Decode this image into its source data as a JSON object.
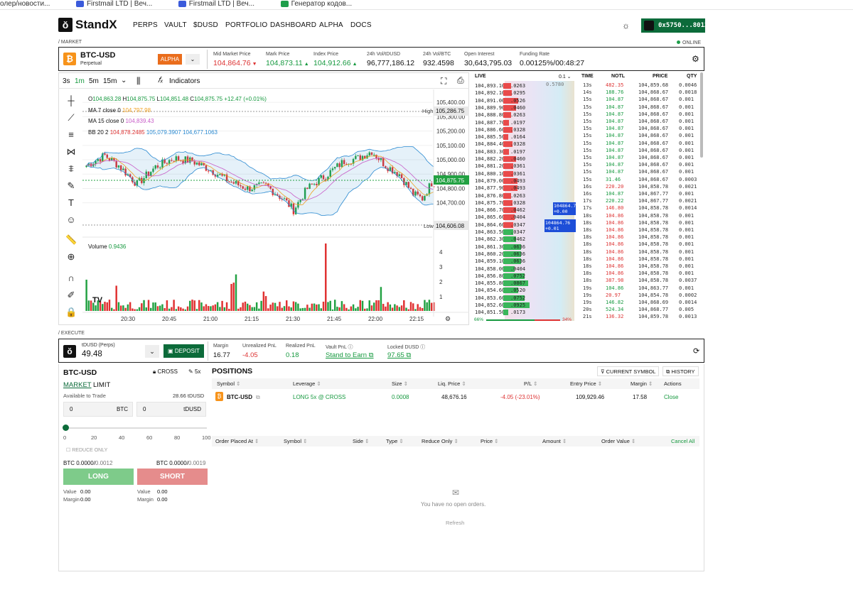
{
  "bookmarks": [
    "олер/новости...",
    "Firstmail LTD | Веч...",
    "Firstmail LTD | Веч...",
    "Генератор кодов..."
  ],
  "nav": {
    "logo": "StandX",
    "links": [
      "PERPS",
      "VAULT",
      "$DUSD",
      "PORTFOLIO",
      "DASHBOARD",
      "ALPHA",
      "DOCS"
    ],
    "wallet": "0x5750...8012"
  },
  "section_market": "/ MARKET",
  "online": "ONLINE",
  "market": {
    "symbol": "BTC-USD",
    "type": "Perpetual",
    "badge": "ALPHA",
    "stats": [
      {
        "label": "Mid Market Price",
        "value": "104,864.76",
        "color": "red",
        "arrow": "down"
      },
      {
        "label": "Mark Price",
        "value": "104,873.11",
        "color": "green",
        "arrow": "up"
      },
      {
        "label": "Index Price",
        "value": "104,912.66",
        "color": "green",
        "arrow": "up"
      },
      {
        "label": "24h Vol/tDUSD",
        "value": "96,777,186.12",
        "color": "black",
        "arrow": ""
      },
      {
        "label": "24h Vol/BTC",
        "value": "932.4598",
        "color": "black",
        "arrow": ""
      },
      {
        "label": "Open Interest",
        "value": "30,643,795.03",
        "color": "black",
        "arrow": ""
      },
      {
        "label": "Funding Rate",
        "value": "0.00125%/00:48:27",
        "color": "black",
        "arrow": ""
      }
    ]
  },
  "chart": {
    "intervals": [
      "3s",
      "1m",
      "5m",
      "15m"
    ],
    "active_interval": "1m",
    "indicators_label": "Indicators",
    "ohlc": {
      "o": "104,863.28",
      "h": "104,875.75",
      "l": "104,851.48",
      "c": "104,875.75",
      "chg": "+12.47 (+0.01%)"
    },
    "ma7": {
      "label": "MA 7 close 0",
      "value": "104,797.98"
    },
    "ma15": {
      "label": "MA 15 close 0",
      "value": "104,839.43"
    },
    "bb": {
      "label": "BB 20 2",
      "v1": "104,878.2485",
      "v2": "105,079.3907",
      "v3": "104,677.1063"
    },
    "volume_label": "Volume",
    "volume_value": "0.9436",
    "high_label": "High",
    "high_value": "105,286.75",
    "low_label": "Low",
    "low_value": "104,606.08",
    "current_price": "104,875.75",
    "price_ticks": [
      "105,400.00",
      "105,300.00",
      "105,200.00",
      "105,100.00",
      "105,000.00",
      "104,900.00",
      "104,800.00",
      "104,700.00"
    ],
    "vol_ticks": [
      "4",
      "3",
      "2",
      "1"
    ],
    "time_ticks": [
      "20:30",
      "20:45",
      "21:00",
      "21:15",
      "21:30",
      "21:45",
      "22:00",
      "22:15"
    ]
  },
  "chart_data": {
    "type": "candlestick",
    "x_label": "time",
    "y_label": "price",
    "ylim": [
      104550,
      105450
    ],
    "series_colors": {
      "up": "#22a142",
      "down": "#e03131",
      "ma7": "#f0a020",
      "ma15": "#c85cc8",
      "bb": "#2b8ad1"
    }
  },
  "orderbook": {
    "title": "LIVE",
    "step": "0.1",
    "asks": [
      [
        "104,893.10",
        ".0263"
      ],
      [
        "104,892.10",
        ".0295"
      ],
      [
        "104,891.00",
        ".0526"
      ],
      [
        "104,889.90",
        ".0460"
      ],
      [
        "104,888.80",
        ".0263"
      ],
      [
        "104,887.70",
        ".0197"
      ],
      [
        "104,886.60",
        ".0328"
      ],
      [
        "104,885.50",
        ".0164"
      ],
      [
        "104,884.40",
        ".0328"
      ],
      [
        "104,883.30",
        ".0197"
      ],
      [
        "104,882.20",
        ".0460"
      ],
      [
        "104,881.20",
        ".0361"
      ],
      [
        "104,880.10",
        ".0361"
      ],
      [
        "104,879.00",
        ".0493"
      ],
      [
        "104,877.90",
        ".0493"
      ],
      [
        "104,876.80",
        ".0263"
      ],
      [
        "104,875.70",
        ".0328"
      ],
      [
        "104,866.70",
        ".0462"
      ],
      [
        "104,865.60",
        ".0404"
      ],
      [
        "104,864.60",
        ".0347"
      ]
    ],
    "bids": [
      [
        "104,863.50",
        ".0347"
      ],
      [
        "104,862.30",
        ".0462"
      ],
      [
        "104,861.30",
        ".0636"
      ],
      [
        "104,860.20",
        ".0636"
      ],
      [
        "104,859.10",
        ".0636"
      ],
      [
        "104,858.00",
        ".0404"
      ],
      [
        "104,856.80",
        ".0752"
      ],
      [
        "104,855.80",
        ".0867"
      ],
      [
        "104,854.60",
        ".0520"
      ],
      [
        "104,853.60",
        ".0752"
      ],
      [
        "104,852.60",
        ".0925"
      ],
      [
        "104,851.50",
        ".0173"
      ]
    ],
    "tag1": "104864.76",
    "tag1b": "+0.00",
    "tag2": "104864.76",
    "tag2b": "+0.01",
    "top_value": "0.5780",
    "bid_pct": "66%",
    "ask_pct": "34%"
  },
  "trades": {
    "headers": [
      "TIME",
      "NOTL",
      "PRICE",
      "QTY"
    ],
    "rows": [
      [
        "13s",
        "482.35",
        "104,859.68",
        "0.0046",
        "r"
      ],
      [
        "14s",
        "188.76",
        "104,868.67",
        "0.0018",
        "g"
      ],
      [
        "15s",
        "104.87",
        "104,868.67",
        "0.001",
        "g"
      ],
      [
        "15s",
        "104.87",
        "104,868.67",
        "0.001",
        "g"
      ],
      [
        "15s",
        "104.87",
        "104,868.67",
        "0.001",
        "g"
      ],
      [
        "15s",
        "104.87",
        "104,868.67",
        "0.001",
        "g"
      ],
      [
        "15s",
        "104.87",
        "104,868.67",
        "0.001",
        "g"
      ],
      [
        "15s",
        "104.87",
        "104,868.67",
        "0.001",
        "g"
      ],
      [
        "15s",
        "104.87",
        "104,868.67",
        "0.001",
        "g"
      ],
      [
        "15s",
        "104.87",
        "104,868.67",
        "0.001",
        "g"
      ],
      [
        "15s",
        "104.87",
        "104,868.67",
        "0.001",
        "g"
      ],
      [
        "15s",
        "104.87",
        "104,868.67",
        "0.001",
        "g"
      ],
      [
        "15s",
        "104.87",
        "104,868.67",
        "0.001",
        "g"
      ],
      [
        "15s",
        "31.46",
        "104,868.67",
        "0.0003",
        "g"
      ],
      [
        "16s",
        "220.20",
        "104,858.78",
        "0.0021",
        "r"
      ],
      [
        "16s",
        "104.87",
        "104,867.77",
        "0.001",
        "g"
      ],
      [
        "17s",
        "220.22",
        "104,867.77",
        "0.0021",
        "g"
      ],
      [
        "17s",
        "146.80",
        "104,858.78",
        "0.0014",
        "r"
      ],
      [
        "18s",
        "104.86",
        "104,858.78",
        "0.001",
        "r"
      ],
      [
        "18s",
        "104.86",
        "104,858.78",
        "0.001",
        "r"
      ],
      [
        "18s",
        "104.86",
        "104,858.78",
        "0.001",
        "r"
      ],
      [
        "18s",
        "104.86",
        "104,858.78",
        "0.001",
        "r"
      ],
      [
        "18s",
        "104.86",
        "104,858.78",
        "0.001",
        "r"
      ],
      [
        "18s",
        "104.86",
        "104,858.78",
        "0.001",
        "r"
      ],
      [
        "18s",
        "104.86",
        "104,858.78",
        "0.001",
        "r"
      ],
      [
        "18s",
        "104.86",
        "104,858.78",
        "0.001",
        "r"
      ],
      [
        "18s",
        "104.86",
        "104,858.78",
        "0.001",
        "r"
      ],
      [
        "18s",
        "387.98",
        "104,858.78",
        "0.0037",
        "r"
      ],
      [
        "19s",
        "104.86",
        "104,863.77",
        "0.001",
        "g"
      ],
      [
        "19s",
        "20.97",
        "104,854.78",
        "0.0002",
        "r"
      ],
      [
        "19s",
        "146.82",
        "104,868.69",
        "0.0014",
        "g"
      ],
      [
        "20s",
        "524.34",
        "104,868.77",
        "0.005",
        "g"
      ],
      [
        "21s",
        "136.32",
        "104,859.78",
        "0.0013",
        "r"
      ]
    ]
  },
  "section_execute": "/ EXECUTE",
  "account": {
    "asset": "tDUSD (Perps)",
    "balance": "49.48",
    "deposit": "DEPOSIT",
    "stats": [
      {
        "label": "Margin",
        "value": "16.77",
        "color": "black",
        "link": false
      },
      {
        "label": "Unrealized PnL",
        "value": "-4.05",
        "color": "red",
        "link": false
      },
      {
        "label": "Realized PnL",
        "value": "0.18",
        "color": "green",
        "link": false
      },
      {
        "label": "Vault PnL",
        "value": "Stand to Earn",
        "color": "green",
        "link": true
      },
      {
        "label": "Locked DUSD",
        "value": "97.65",
        "color": "green",
        "link": true
      }
    ]
  },
  "order_form": {
    "symbol": "BTC-USD",
    "cross": "CROSS",
    "leverage": "5x",
    "tab_market": "MARKET",
    "tab_limit": "LIMIT",
    "avail_label": "Available to Trade",
    "avail_value": "28.66",
    "avail_unit": "tDUSD",
    "qty1": "0",
    "unit1": "BTC",
    "qty2": "0",
    "unit2": "tDUSD",
    "slider_ticks": [
      "0",
      "20",
      "40",
      "60",
      "80",
      "100"
    ],
    "reduce_only": "REDUCE ONLY",
    "long_size": "BTC 0.0000/",
    "long_max": "0.0012",
    "short_size": "BTC 0.0000/",
    "short_max": "0.0019",
    "long_btn": "LONG",
    "short_btn": "SHORT",
    "value_label": "Value",
    "margin_label": "Margin",
    "long_value": "0.00",
    "long_margin": "0.00",
    "short_value": "0.00",
    "short_margin": "0.00"
  },
  "positions": {
    "title": "POSITIONS",
    "current_symbol": "CURRENT SYMBOL",
    "history": "HISTORY",
    "headers": [
      "Symbol",
      "Leverage",
      "Size",
      "Liq. Price",
      "P/L",
      "Entry Price",
      "Margin",
      "Actions"
    ],
    "row": {
      "symbol": "BTC-USD",
      "leverage": "LONG 5x @ CROSS",
      "size": "0.0008",
      "liq": "48,676.16",
      "pl": "-4.05 (-23.01%)",
      "entry": "109,929.46",
      "margin": "17.58",
      "action": "Close"
    }
  },
  "orders": {
    "headers": [
      "Order Placed At",
      "Symbol",
      "Side",
      "Type",
      "Reduce Only",
      "Price",
      "Amount",
      "Order Value"
    ],
    "cancel_all": "Cancel All",
    "empty": "You have no open orders.",
    "refresh": "Refresh"
  }
}
